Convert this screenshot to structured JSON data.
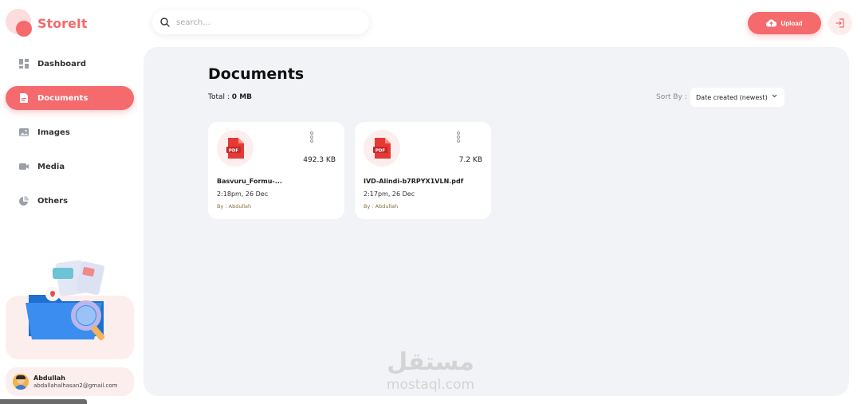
{
  "app": {
    "name": "StoreIt",
    "brand_color": "#f56a6c"
  },
  "sidebar": {
    "items": [
      {
        "label": "Dashboard",
        "icon": "dashboard-icon",
        "active": false
      },
      {
        "label": "Documents",
        "icon": "document-icon",
        "active": true
      },
      {
        "label": "Images",
        "icon": "image-icon",
        "active": false
      },
      {
        "label": "Media",
        "icon": "video-icon",
        "active": false
      },
      {
        "label": "Others",
        "icon": "pie-chart-icon",
        "active": false
      }
    ],
    "user": {
      "name": "Abdullah",
      "email": "abdallahalhasan2@gmail.com"
    }
  },
  "header": {
    "search_placeholder": "search...",
    "upload_label": "Upload"
  },
  "main": {
    "title": "Documents",
    "total_label": "Total :",
    "total_value": "0 MB",
    "sort_label": "Sort By :",
    "sort_value": "Date created (newest)",
    "files": [
      {
        "name": "Basvuru_Formu-...",
        "size": "492.3 KB",
        "date": "2:18pm, 26 Dec",
        "owner": "By : Abdullah",
        "type": "PDF"
      },
      {
        "name": "IVD-Alindi-b7RPYX1VLN.pdf",
        "size": "7.2 KB",
        "date": "2:17pm, 26 Dec",
        "owner": "By : Abdullah",
        "type": "PDF"
      }
    ]
  },
  "watermark": {
    "arabic": "مستقل",
    "latin": "mostaql.com"
  }
}
